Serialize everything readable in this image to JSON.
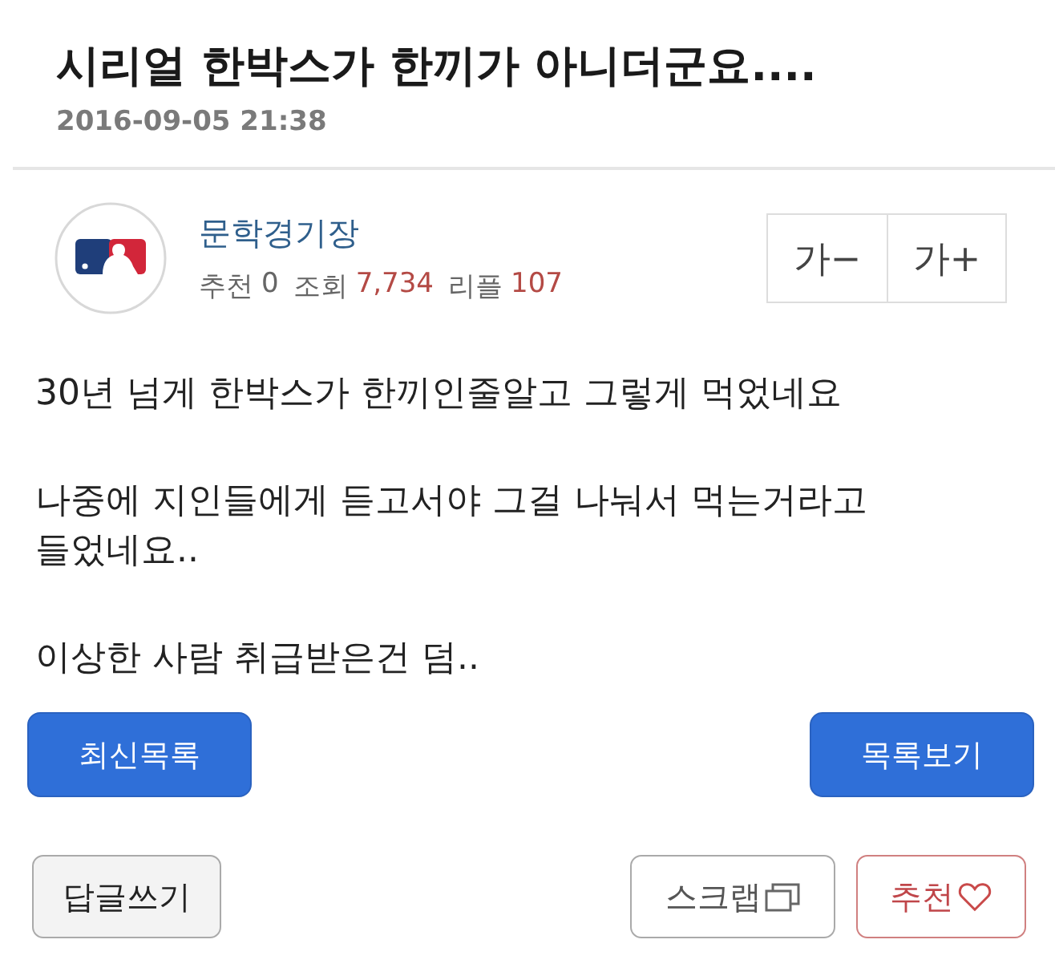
{
  "title": "시리얼 한박스가 한끼가 아니더군요....",
  "date": "2016-09-05 21:38",
  "author": {
    "name": "문학경기장",
    "stats": [
      {
        "label": "추천",
        "value": "0",
        "highlight": false
      },
      {
        "label": "조회",
        "value": "7,734",
        "highlight": true
      },
      {
        "label": "리플",
        "value": "107",
        "highlight": true
      }
    ]
  },
  "font_buttons": [
    "가−",
    "가+"
  ],
  "body": [
    "30년 넘게 한박스가 한끼인줄알고 그렇게 먹었네요",
    "나중에 지인들에게 듣고서야 그걸 나눠서 먹는거라고 들었네요..",
    "이상한 사람 취급받은건 덤.."
  ],
  "nav_buttons": [
    "최신목록",
    "목록보기"
  ],
  "actions": [
    {
      "label": "답글쓰기",
      "kind": "reply"
    },
    {
      "label": "스크랩",
      "kind": "scrap"
    },
    {
      "label": "추천",
      "kind": "recommend"
    }
  ]
}
